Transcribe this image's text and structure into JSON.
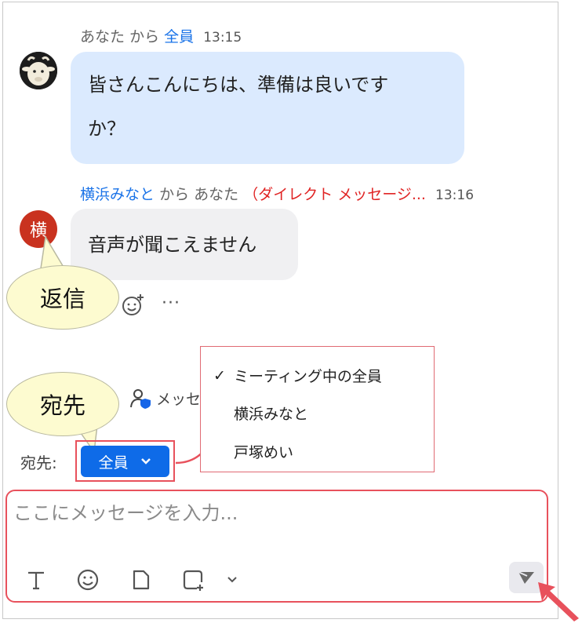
{
  "messages": {
    "first": {
      "from": "あなた",
      "connector": "から",
      "to": "全員",
      "time": "13:15",
      "text_line1": "皆さんこんにちは、準備は良いです",
      "text_line2": "か？"
    },
    "second": {
      "from": "横浜みなと",
      "connector": "から",
      "to": "あなた",
      "direct_tag": "（ダイレクト メッセージ...",
      "time": "13:16",
      "avatar_letter": "横",
      "text": "音声が聞こえません"
    }
  },
  "reactions": {
    "more": "···"
  },
  "callouts": {
    "reply": "返信",
    "recipient": "宛先"
  },
  "message_tab": {
    "label": "メッセ"
  },
  "recipient": {
    "label": "宛先:",
    "selected": "全員"
  },
  "dropdown": {
    "items": [
      {
        "label": "ミーティング中の全員",
        "checked": "✓"
      },
      {
        "label": "横浜みなと",
        "checked": ""
      },
      {
        "label": "戸塚めい",
        "checked": ""
      }
    ]
  },
  "composer": {
    "placeholder": "ここにメッセージを入力..."
  },
  "colors": {
    "accent": "#0e6be8",
    "highlight": "#e8515c",
    "bubble": "#dbeafe",
    "direct": "#e02424"
  },
  "icons": [
    "goat-avatar-icon",
    "add-reaction-icon",
    "more-icon",
    "person-shield-icon",
    "chevron-down-icon",
    "text-format-icon",
    "emoji-icon",
    "file-icon",
    "screenshot-icon",
    "send-icon"
  ]
}
